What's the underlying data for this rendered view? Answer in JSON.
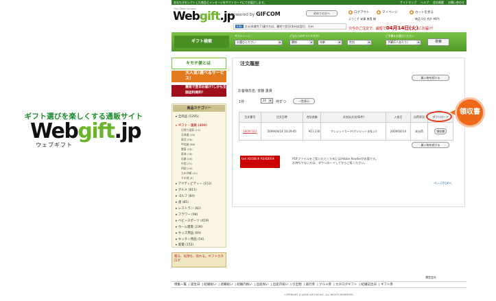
{
  "promo": {
    "tagline": "ギフト選びを楽しくする通販サイト",
    "logo_main": "Web",
    "logo_gift": "gift",
    "logo_tld": ".jp",
    "logo_sub": "ウェブギフト"
  },
  "topbar": {
    "message": "あなたがセレクトした商品とメッセージをギフトカードにてお届けします。",
    "links": [
      "サイトマップ",
      "ヘルプ",
      "会社概要",
      "お問い合わせ"
    ]
  },
  "header": {
    "small": "Fun Dear Unique",
    "brand_web": "Web",
    "brand_gift": "gift",
    "brand_tld": ".jp",
    "powered": "powered by",
    "gifcom": "GIFCOM",
    "first_button": "初めての方へ",
    "logout": "ログアウト",
    "mypage": "マイページ",
    "cart": "カートを見る",
    "welcome": "ようこそ 安藤 勇貴 様",
    "count_info": "商品 0点  合計 ¥0円",
    "info_tag": "Info",
    "info_text": "文◎(本渡完了)乗すれば、最短で翌日(本州は翌日、九州",
    "delivery_prefix": "只今のご注文で、最短で",
    "delivery_date": "04月14日(火)",
    "delivery_suffix": "にお届け!"
  },
  "search": {
    "title": "ギフト検索",
    "labels": [
      "ギフトシーン",
      "どなたへのギフトですか?",
      "",
      "ご予算をお選びください"
    ],
    "selects": [
      "お選びください",
      "関係",
      "年齢",
      "性別",
      "予算(1人あたり)"
    ],
    "button": "検索"
  },
  "banners": [
    "キモチ便とは",
    "大人気!選べるサービス!",
    "最短で翌日お届け!しかも全国送料無料!"
  ],
  "categories": {
    "title": "商品カテゴリー",
    "items": [
      "▸ 全商品 (5295)",
      "▸ ギフト・温泉 (400)",
      "▸ アクティビティー (153)",
      "▸ グルメ (811)",
      "▸ ゴルフ (84)",
      "▸ 酒 (85)",
      "▸ レストラン (82)",
      "▸ フラワー (98)",
      "▸ ベビースポーツ (459)",
      "▸ ホーム雑貨 (236)",
      "▸ キッズ用品 (69)",
      "▸ キッチン用品 (54)",
      "▸ 家電 (152)"
    ],
    "subs": [
      "日帰り温泉 (14)",
      "北海道 (18)",
      "東北 (58)",
      "甲信越 (86)",
      "関東 (58)",
      "東海 (38)",
      "近畿 (46)",
      "中国 (31)",
      "四国 (16)",
      "九州沖縄 (41)",
      "その他 (4)"
    ],
    "catalog": "贈る、気持ち、伝わる。ギフトカタログ"
  },
  "main": {
    "title": "注文履歴",
    "back_button": "買い物を続ける",
    "customer": "お客様氏名: 安藤 勇貴",
    "count": "1件",
    "per_page": "20",
    "per_page_label": "件ずつ",
    "list_button": "一覧表示"
  },
  "table": {
    "headers": [
      "注文番号",
      "注文日時",
      "合計金額",
      "お支払方法(条件)",
      "入金日",
      "出荷状況",
      "ダウンロード"
    ],
    "row": {
      "order_no": "10000163",
      "date": "2009/04/14 10:29:45",
      "total": "¥11,130",
      "payment": "クレジットカード(クレジット支払い)",
      "paid": "2009/04/14",
      "status": "未出荷",
      "download": "領収書"
    }
  },
  "pdf": {
    "adobe": "Get ADOBE® READER®",
    "note1": "PDFファイルをご覧いただくためにはAdobe Readerが必要です。",
    "note2": "お持ちでない方は、ダウンロードしてからご覧ください。"
  },
  "page_top": "ページTOPへ",
  "company": "運営会社",
  "footer": [
    "特集一覧",
    "誕生日",
    "結婚祝い",
    "退職祝い",
    "結婚内祝い",
    "出産祝い",
    "出産内祝い",
    "引出物",
    "旅行券",
    "グルメ券",
    "カタログギフト",
    "結婚記念日",
    "ギフト券"
  ],
  "copyright": "COPYRIGHT (C)2008 GIFCOM INC. ALL RIGHTS RESERVED.",
  "callout": "領収書",
  "colors": {
    "green": "#4f9a2a",
    "orange": "#ef6a18",
    "red": "#e8341c"
  }
}
